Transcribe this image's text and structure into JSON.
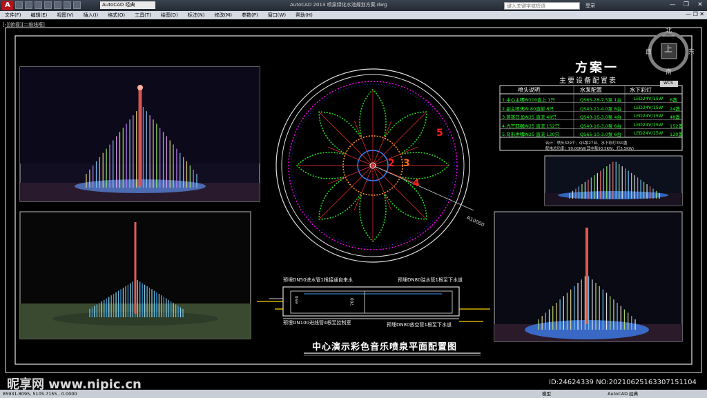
{
  "titlebar": {
    "app_logo": "A",
    "workspace": "AutoCAD 经典",
    "window_title": "AutoCAD 2013    喷泉绿化水池规划方案.dwg",
    "search_placeholder": "键入关键字或短语",
    "login": "登录",
    "controls": [
      "—",
      "❐",
      "✕"
    ]
  },
  "menu": [
    "文件(F)",
    "编辑(E)",
    "视图(V)",
    "插入(I)",
    "格式(O)",
    "工具(T)",
    "绘图(D)",
    "标注(N)",
    "修改(M)",
    "参数(P)",
    "窗口(W)",
    "帮助(H)"
  ],
  "doc_controls": "— ❐ ✕",
  "view_label": "[-][俯视][二维线框]",
  "viewcube": {
    "north": "北",
    "south": "南",
    "east": "东",
    "west": "西",
    "face": "上",
    "wcs": "WCS"
  },
  "plan": {
    "title": "方案一",
    "table_title": "主要设备配置表",
    "headers": [
      "喷头说明",
      "水泵配置",
      "水下彩灯"
    ],
    "rows": [
      [
        "1.中心主喷",
        "DN100直上 1只",
        "QS65-28-7.5泵 1台",
        "LED24V/15W",
        "6盏"
      ],
      [
        "2.副主喷头",
        "DN 80直射 8只",
        "QS40-21-4.0泵 8台",
        "LED24V/15W",
        "24盏"
      ],
      [
        "3.蒸蒸日上",
        "DN25 直流 48只",
        "QS40-16-3.0泵 4台",
        "LED24V/15W",
        "48盏"
      ],
      [
        "4.光芒四射",
        "DN25 直流 152只",
        "QS40-16-3.0泵 6台",
        "LED24V/15W",
        "152盏"
      ],
      [
        "5.弯形拱喷",
        "DN25 直流 120只",
        "QS65-10-3.0泵 6台",
        "LED24V/15W",
        "120盏"
      ]
    ],
    "footer1": "合计：喷头329个、QS泵27台、水下彩灯350盏",
    "footer2": "配电总功率：99.00KW(其中泵93.5KW、灯5.5KW)",
    "circle_labels": [
      "1",
      "2",
      "3",
      "4",
      "5"
    ],
    "radius_label": "R10000",
    "drawing_title": "中心演示彩色音乐喷泉平面配置图"
  },
  "section": {
    "note_tl": "预埋DN50进水管1根接通自来水",
    "note_tr": "预埋DN80溢水管1根至下水道",
    "note_bl": "预埋DN100进线管4根至控制室",
    "note_br": "预埋DN80放空管1根至下水道",
    "dim1": "650",
    "dim2": "700"
  },
  "status": {
    "coords": "85931.8095, 5105.7155 , 0.0000",
    "model": "模型",
    "right": "AutoCAD 经典"
  },
  "watermark_left": "昵享网 www.nipic.cn",
  "watermark_right": "ID:24624339 NO:20210625163307151104"
}
